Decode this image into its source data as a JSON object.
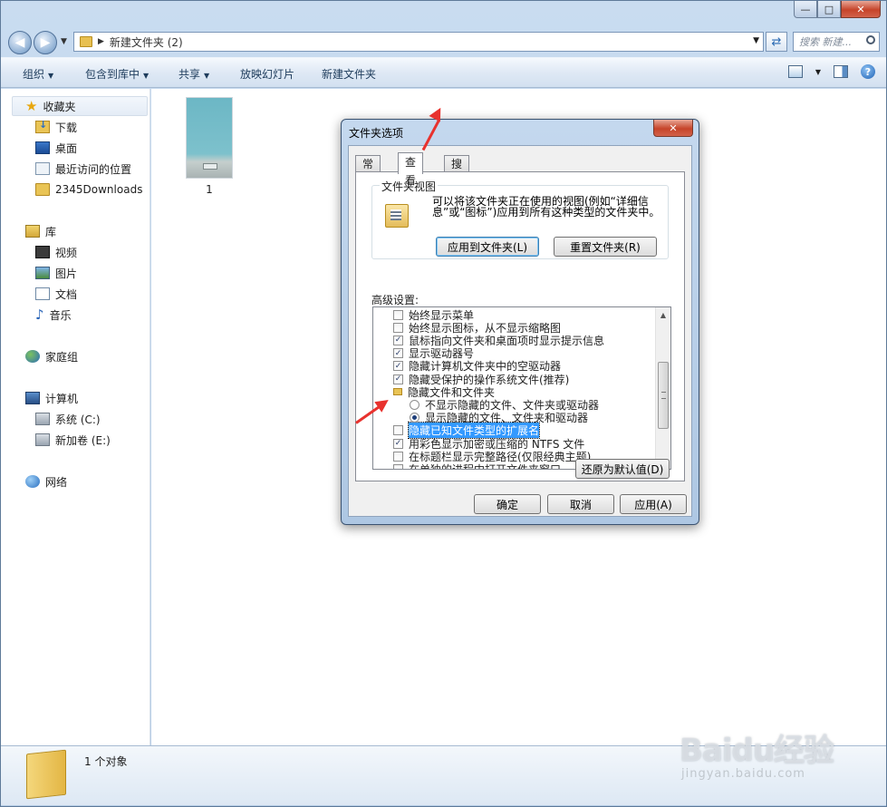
{
  "window": {
    "caption_buttons": {
      "minimize": "—",
      "maximize": "□",
      "close": "✕"
    }
  },
  "address": {
    "path": "新建文件夹 (2)",
    "search_placeholder": "搜索 新建..."
  },
  "toolbar": {
    "organize": "组织",
    "include_in_library": "包含到库中",
    "share": "共享",
    "slideshow": "放映幻灯片",
    "new_folder": "新建文件夹"
  },
  "sidebar": {
    "favorites": {
      "label": "收藏夹",
      "items": [
        "下载",
        "桌面",
        "最近访问的位置",
        "2345Downloads"
      ]
    },
    "libraries": {
      "label": "库",
      "items": [
        "视频",
        "图片",
        "文档",
        "音乐"
      ]
    },
    "homegroup": "家庭组",
    "computer": {
      "label": "计算机",
      "items": [
        "系统 (C:)",
        "新加卷 (E:)"
      ]
    },
    "network": "网络"
  },
  "content": {
    "items": [
      {
        "label": "1"
      }
    ]
  },
  "status": {
    "text": "1 个对象"
  },
  "dialog": {
    "title": "文件夹选项",
    "close": "✕",
    "tabs": [
      "常规",
      "查看",
      "搜索"
    ],
    "active_tab": "查看",
    "folder_views": {
      "title": "文件夹视图",
      "description": "可以将该文件夹正在使用的视图(例如“详细信息”或“图标”)应用到所有这种类型的文件夹中。",
      "apply_button": "应用到文件夹(L)",
      "reset_button": "重置文件夹(R)"
    },
    "advanced_label": "高级设置:",
    "advanced_items": [
      {
        "type": "checkbox",
        "checked": false,
        "label": "始终显示菜单"
      },
      {
        "type": "checkbox",
        "checked": false,
        "label": "始终显示图标，从不显示缩略图"
      },
      {
        "type": "checkbox",
        "checked": true,
        "label": "鼠标指向文件夹和桌面项时显示提示信息"
      },
      {
        "type": "checkbox",
        "checked": true,
        "label": "显示驱动器号"
      },
      {
        "type": "checkbox",
        "checked": true,
        "label": "隐藏计算机文件夹中的空驱动器"
      },
      {
        "type": "checkbox",
        "checked": true,
        "label": "隐藏受保护的操作系统文件(推荐)"
      },
      {
        "type": "folder",
        "label": "隐藏文件和文件夹"
      },
      {
        "type": "radio",
        "checked": false,
        "label": "不显示隐藏的文件、文件夹或驱动器"
      },
      {
        "type": "radio",
        "checked": true,
        "label": "显示隐藏的文件、文件夹和驱动器"
      },
      {
        "type": "checkbox",
        "checked": false,
        "label": "隐藏已知文件类型的扩展名",
        "highlighted": true
      },
      {
        "type": "checkbox",
        "checked": true,
        "label": "用彩色显示加密或压缩的 NTFS 文件"
      },
      {
        "type": "checkbox",
        "checked": false,
        "label": "在标题栏显示完整路径(仅限经典主题)"
      },
      {
        "type": "checkbox",
        "checked": false,
        "label": "在单独的进程中打开文件夹窗口"
      }
    ],
    "restore_defaults": "还原为默认值(D)",
    "ok": "确定",
    "cancel": "取消",
    "apply": "应用(A)"
  },
  "watermark": {
    "main": "Baidu经验",
    "sub": "jingyan.baidu.com"
  },
  "colors": {
    "annotation_arrow": "#e8322e",
    "selection": "#3399ff"
  }
}
